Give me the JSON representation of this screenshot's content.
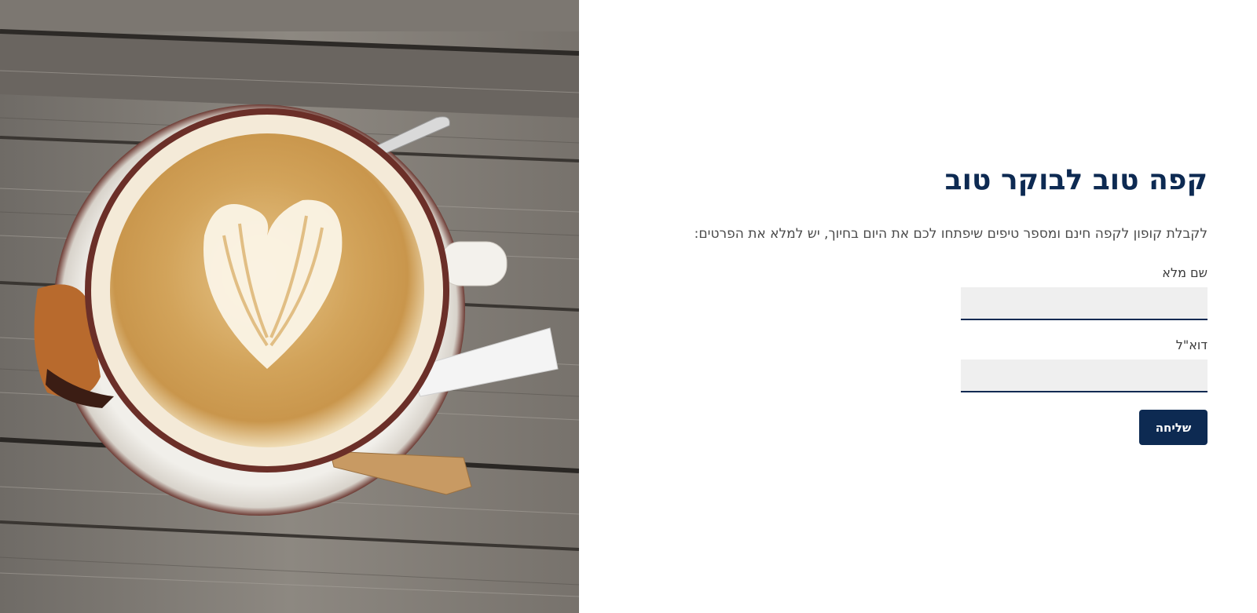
{
  "hero": {
    "image_name": "coffee-cup-photo"
  },
  "form": {
    "title": "קפה טוב לבוקר טוב",
    "subtitle": "לקבלת קופון לקפה חינם ומספר טיפים שיפתחו לכם את היום בחיוך, יש למלא את הפרטים:",
    "fields": [
      {
        "label": "שם מלא",
        "value": "",
        "placeholder": ""
      },
      {
        "label": "דוא\"ל",
        "value": "",
        "placeholder": ""
      }
    ],
    "submit_label": "שליחה"
  },
  "colors": {
    "brand_navy": "#0d2a52",
    "input_bg": "#efefef",
    "text_gray": "#4a4a4a"
  }
}
